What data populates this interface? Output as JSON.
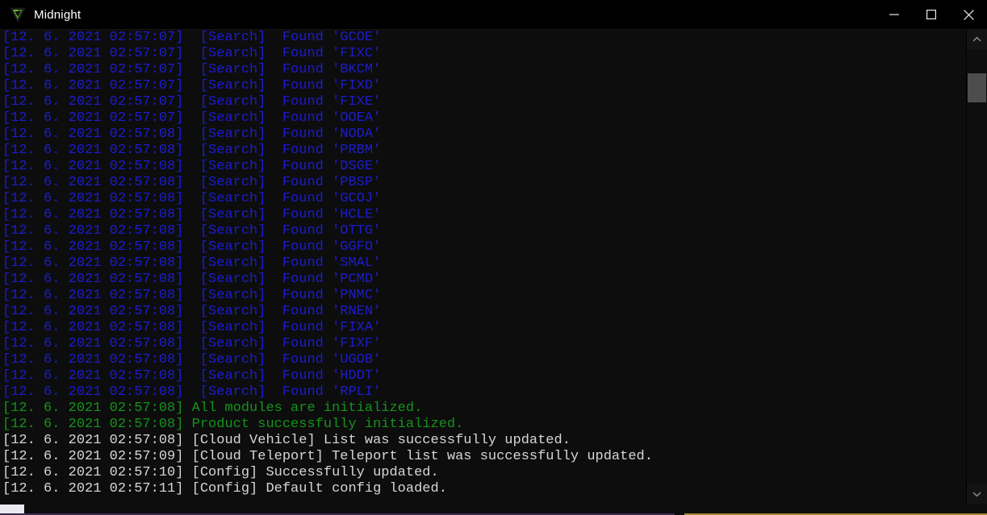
{
  "window": {
    "title": "Midnight",
    "icon": "app-logo-v-icon",
    "background": "#0d0d0d",
    "titlebar_background": "#000000"
  },
  "titlebar": {
    "minimize_label": "minimize",
    "maximize_label": "maximize",
    "close_label": "close"
  },
  "colors": {
    "blue": "#1c1ccf",
    "green": "#14931c",
    "white": "#d6d6d6",
    "scrollbar_thumb": "#4d4d4d",
    "accent_purple": "#3b2a4c",
    "accent_gold": "#a4862c"
  },
  "scrollbars": {
    "vertical": {
      "up_arrow_icon": "chevron-up-icon",
      "down_arrow_icon": "chevron-down-icon",
      "thumb_position_percent": 6
    },
    "horizontal": {
      "thumb_position_percent": 0
    }
  },
  "console": {
    "lines": [
      {
        "text": "[12. 6. 2021 02:57:07]  [Search]  Found 'GCOE'",
        "color": "blue"
      },
      {
        "text": "[12. 6. 2021 02:57:07]  [Search]  Found 'FIXC'",
        "color": "blue"
      },
      {
        "text": "[12. 6. 2021 02:57:07]  [Search]  Found 'BKCM'",
        "color": "blue"
      },
      {
        "text": "[12. 6. 2021 02:57:07]  [Search]  Found 'FIXD'",
        "color": "blue"
      },
      {
        "text": "[12. 6. 2021 02:57:07]  [Search]  Found 'FIXE'",
        "color": "blue"
      },
      {
        "text": "[12. 6. 2021 02:57:07]  [Search]  Found 'OOEA'",
        "color": "blue"
      },
      {
        "text": "[12. 6. 2021 02:57:08]  [Search]  Found 'NODA'",
        "color": "blue"
      },
      {
        "text": "[12. 6. 2021 02:57:08]  [Search]  Found 'PRBM'",
        "color": "blue"
      },
      {
        "text": "[12. 6. 2021 02:57:08]  [Search]  Found 'DSGE'",
        "color": "blue"
      },
      {
        "text": "[12. 6. 2021 02:57:08]  [Search]  Found 'PBSP'",
        "color": "blue"
      },
      {
        "text": "[12. 6. 2021 02:57:08]  [Search]  Found 'GCOJ'",
        "color": "blue"
      },
      {
        "text": "[12. 6. 2021 02:57:08]  [Search]  Found 'HCLE'",
        "color": "blue"
      },
      {
        "text": "[12. 6. 2021 02:57:08]  [Search]  Found 'OTTG'",
        "color": "blue"
      },
      {
        "text": "[12. 6. 2021 02:57:08]  [Search]  Found 'GGFO'",
        "color": "blue"
      },
      {
        "text": "[12. 6. 2021 02:57:08]  [Search]  Found 'SMAL'",
        "color": "blue"
      },
      {
        "text": "[12. 6. 2021 02:57:08]  [Search]  Found 'PCMD'",
        "color": "blue"
      },
      {
        "text": "[12. 6. 2021 02:57:08]  [Search]  Found 'PNMC'",
        "color": "blue"
      },
      {
        "text": "[12. 6. 2021 02:57:08]  [Search]  Found 'RNEN'",
        "color": "blue"
      },
      {
        "text": "[12. 6. 2021 02:57:08]  [Search]  Found 'FIXA'",
        "color": "blue"
      },
      {
        "text": "[12. 6. 2021 02:57:08]  [Search]  Found 'FIXF'",
        "color": "blue"
      },
      {
        "text": "[12. 6. 2021 02:57:08]  [Search]  Found 'UGOB'",
        "color": "blue"
      },
      {
        "text": "[12. 6. 2021 02:57:08]  [Search]  Found 'HDDT'",
        "color": "blue"
      },
      {
        "text": "[12. 6. 2021 02:57:08]  [Search]  Found 'RPLI'",
        "color": "blue"
      },
      {
        "text": "[12. 6. 2021 02:57:08] All modules are initialized.",
        "color": "green"
      },
      {
        "text": "[12. 6. 2021 02:57:08] Product successfully initialized.",
        "color": "green"
      },
      {
        "text": "[12. 6. 2021 02:57:08] [Cloud Vehicle] List was successfully updated.",
        "color": "white"
      },
      {
        "text": "[12. 6. 2021 02:57:09] [Cloud Teleport] Teleport list was successfully updated.",
        "color": "white"
      },
      {
        "text": "[12. 6. 2021 02:57:10] [Config] Successfully updated.",
        "color": "white"
      },
      {
        "text": "[12. 6. 2021 02:57:11] [Config] Default config loaded.",
        "color": "white"
      }
    ]
  }
}
